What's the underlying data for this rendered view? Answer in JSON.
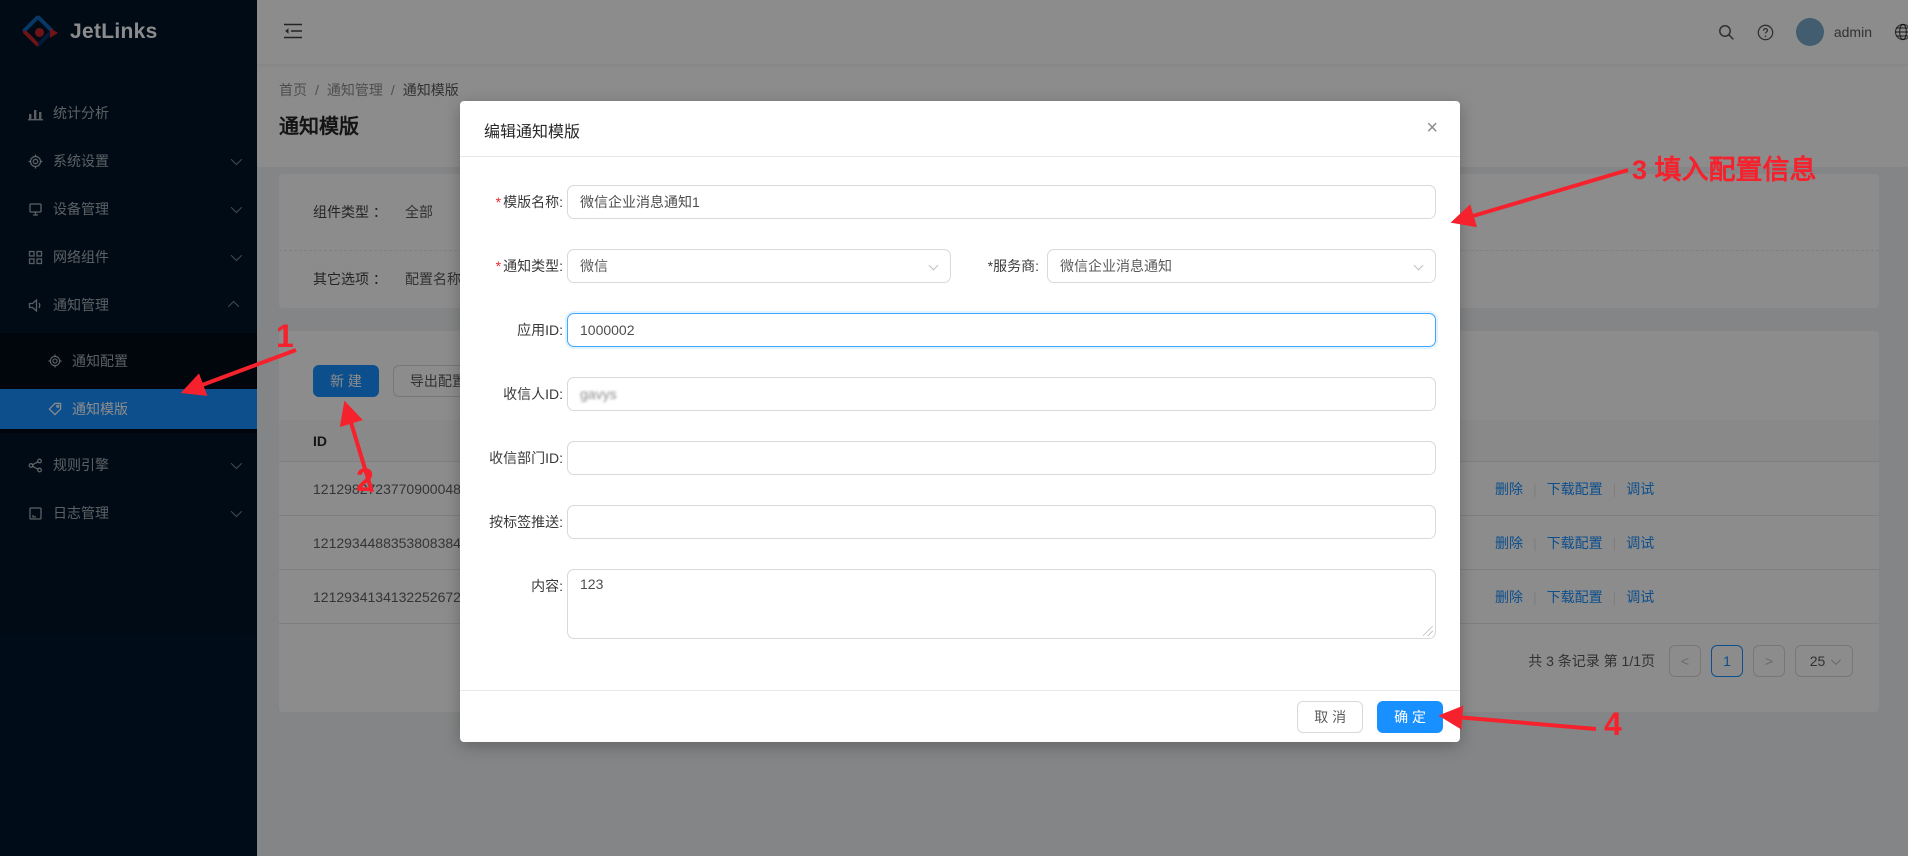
{
  "colors": {
    "primary": "#1890ff",
    "sider_bg": "#001529",
    "submenu_bg": "#000c17",
    "annotation_red": "#f5222d"
  },
  "brand": {
    "name": "JetLinks"
  },
  "topbar": {
    "user": "admin"
  },
  "breadcrumb": {
    "separator": "/",
    "items": [
      "首页",
      "通知管理",
      "通知模版"
    ]
  },
  "page": {
    "title": "通知模版"
  },
  "sidebar": {
    "items": [
      {
        "label": "统计分析"
      },
      {
        "label": "系统设置"
      },
      {
        "label": "设备管理"
      },
      {
        "label": "网络组件"
      },
      {
        "label": "通知管理"
      },
      {
        "label": "规则引擎"
      },
      {
        "label": "日志管理"
      }
    ],
    "submenu": [
      {
        "label": "通知配置"
      },
      {
        "label": "通知模版"
      }
    ]
  },
  "filters": {
    "component_type_label": "组件类型 ：",
    "component_type_value": "全部",
    "other_label": "其它选项 ：",
    "other_value": "配置名称:"
  },
  "toolbar": {
    "new_label": "新 建",
    "export_label": "导出配置"
  },
  "table": {
    "id_header": "ID",
    "rows": [
      {
        "id": "1212982723770900048",
        "actions": [
          "删除",
          "下载配置",
          "调试"
        ]
      },
      {
        "id": "1212934488353808384",
        "actions": [
          "删除",
          "下载配置",
          "调试"
        ]
      },
      {
        "id": "1212934134132252672",
        "actions": [
          "删除",
          "下载配置",
          "调试"
        ]
      }
    ]
  },
  "pagination": {
    "total": "共 3 条记录 第 1/1页",
    "prev": "<",
    "page": "1",
    "next": ">",
    "size": "25"
  },
  "modal": {
    "title": "编辑通知模版",
    "close": "×",
    "required_mark": "*",
    "fields": {
      "template_name": {
        "label": "模版名称:",
        "value": "微信企业消息通知1"
      },
      "notify_type": {
        "label": "通知类型:",
        "value": "微信"
      },
      "provider": {
        "label": "服务商:",
        "value": "微信企业消息通知"
      },
      "app_id": {
        "label": "应用ID:",
        "value": "1000002"
      },
      "receiver": {
        "label": "收信人ID:",
        "value": "gavys"
      },
      "dept": {
        "label": "收信部门ID:",
        "value": ""
      },
      "tag_push": {
        "label": "按标签推送:",
        "value": ""
      },
      "content": {
        "label": "内容:",
        "value": "123"
      }
    },
    "cancel_label": "取 消",
    "ok_label": "确 定"
  },
  "annotations": {
    "step1": "1",
    "step2": "2",
    "step3": "3 填入配置信息",
    "step4": "4"
  }
}
